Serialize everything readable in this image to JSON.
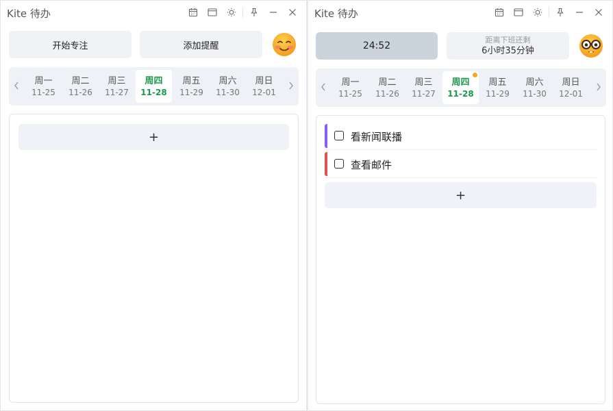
{
  "windows": [
    {
      "title": "Kite 待办",
      "focus_button": "开始专注",
      "reminder_button": "添加提醒",
      "week": [
        {
          "name": "周一",
          "date": "11-25"
        },
        {
          "name": "周二",
          "date": "11-26"
        },
        {
          "name": "周三",
          "date": "11-27"
        },
        {
          "name": "周四",
          "date": "11-28"
        },
        {
          "name": "周五",
          "date": "11-29"
        },
        {
          "name": "周六",
          "date": "11-30"
        },
        {
          "name": "周日",
          "date": "12-01"
        }
      ],
      "selected_day": "周四",
      "add_label": "+"
    },
    {
      "title": "Kite 待办",
      "timer": "24:52",
      "countdown_label": "距离下班还剩",
      "countdown_value": "6小时35分钟",
      "week": [
        {
          "name": "周一",
          "date": "11-25"
        },
        {
          "name": "周二",
          "date": "11-26"
        },
        {
          "name": "周三",
          "date": "11-27"
        },
        {
          "name": "周四",
          "date": "11-28"
        },
        {
          "name": "周五",
          "date": "11-29"
        },
        {
          "name": "周六",
          "date": "11-30"
        },
        {
          "name": "周日",
          "date": "12-01"
        }
      ],
      "selected_day": "周四",
      "tasks": [
        {
          "label": "看新闻联播",
          "color": "#8b5cf6",
          "done": false
        },
        {
          "label": "查看邮件",
          "color": "#d9534f",
          "done": false
        }
      ],
      "add_label": "+"
    }
  ],
  "icons": [
    "calendar-icon",
    "window-icon",
    "sun-icon",
    "pin-icon",
    "minimize-icon",
    "close-icon",
    "chevron-left-icon",
    "chevron-right-icon",
    "smiling-face-icon",
    "nerd-face-icon"
  ],
  "colors": {
    "selected_day": "#1a9a4c",
    "reminder_dot": "#f5a623",
    "timer_bg": "#cbd3dd"
  }
}
